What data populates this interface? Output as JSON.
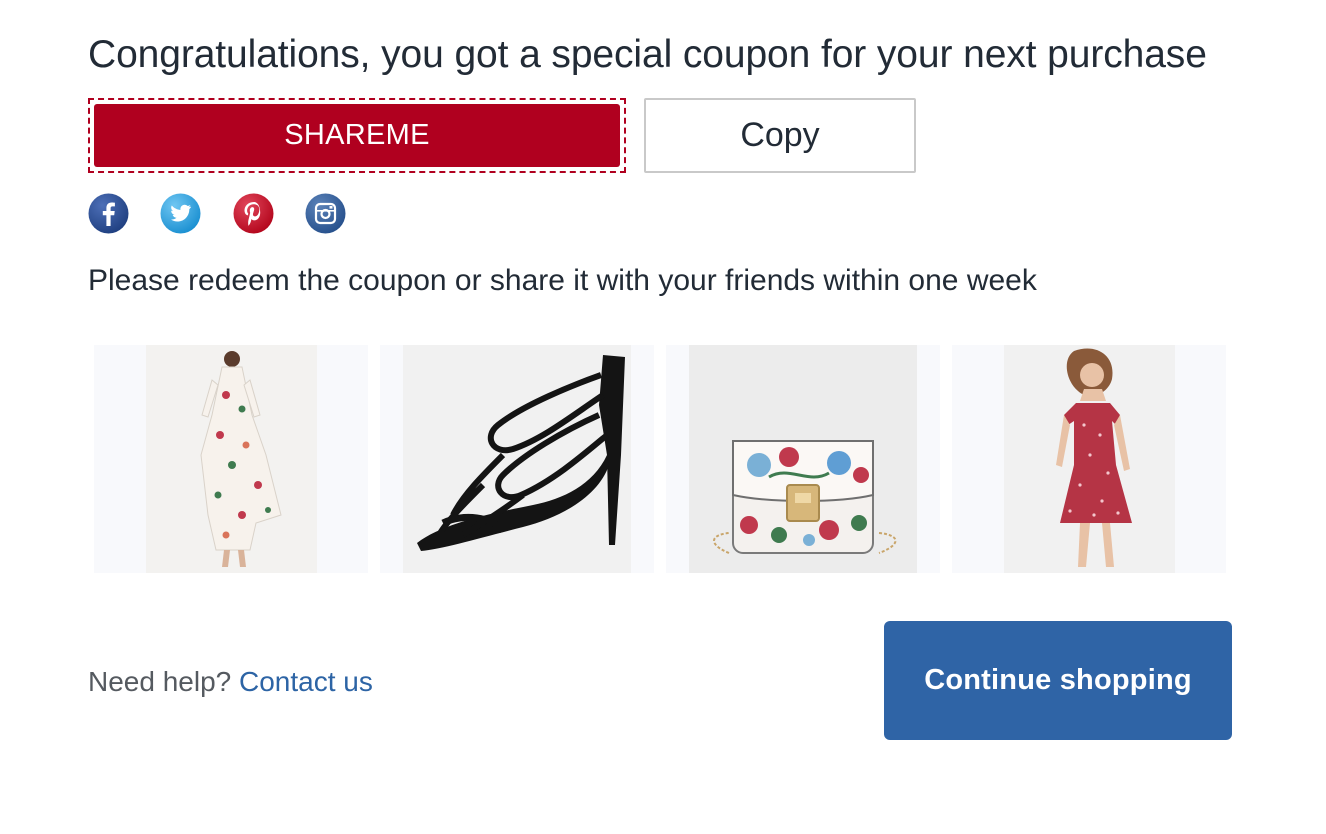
{
  "header": {
    "title": "Congratulations, you got a special coupon for your next purchase"
  },
  "coupon": {
    "code": "SHAREME",
    "copy_label": "Copy"
  },
  "share": {
    "icons": [
      "facebook-icon",
      "twitter-icon",
      "pinterest-icon",
      "instagram-icon"
    ]
  },
  "note": "Please redeem the coupon or share it with your friends within one week",
  "products": [
    {
      "icon": "floral-maxi-dress-image"
    },
    {
      "icon": "black-strappy-heel-image"
    },
    {
      "icon": "floral-crossbody-bag-image"
    },
    {
      "icon": "red-floral-mini-dress-image"
    }
  ],
  "footer": {
    "help_text": "Need help?",
    "contact_link": "Contact us",
    "cta_label": "Continue shopping"
  },
  "colors": {
    "coupon_red": "#b0001f",
    "primary_blue": "#2f64a6",
    "link_blue": "#2d64a5",
    "text": "#222b36"
  }
}
